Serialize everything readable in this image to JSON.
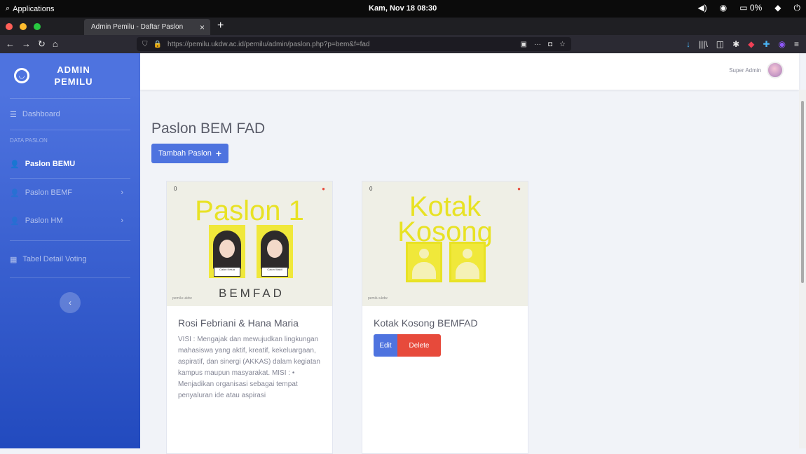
{
  "system": {
    "applications_label": "Applications",
    "clock": "Kam, Nov 18   08:30",
    "battery": "0%"
  },
  "browser": {
    "tab_title": "Admin Pemilu - Daftar Paslon",
    "url": "https://pemilu.ukdw.ac.id/pemilu/admin/paslon.php?p=bem&f=fad"
  },
  "sidebar": {
    "brand": "ADMIN PEMILU",
    "dashboard": "Dashboard",
    "heading": "Data Paslon",
    "items": [
      {
        "label": "Paslon BEMU",
        "active": true
      },
      {
        "label": "Paslon BEMF",
        "has_children": true
      },
      {
        "label": "Paslon HM",
        "has_children": true
      },
      {
        "label": "Tabel Detail Voting"
      }
    ]
  },
  "topbar": {
    "username": "Super Admin"
  },
  "page": {
    "title": "Paslon BEM FAD",
    "add_button": "Tambah Paslon"
  },
  "cards": [
    {
      "poster_number": "0",
      "poster_title": "Paslon 1",
      "poster_footer": "pemilu ukdw",
      "poster_bem": "BEMFAD",
      "name_tag_1": "Calon Ketua",
      "name_tag_2": "Calon Wakil",
      "title": "Rosi Febriani & Hana Maria",
      "text": "VISI : Mengajak dan mewujudkan lingkungan mahasiswa yang aktif, kreatif, kekeluargaan, aspiratif, dan sinergi (AKKAS) dalam kegiatan kampus maupun masyarakat. MISI : • Menjadikan organisasi sebagai tempat penyaluran ide atau aspirasi"
    },
    {
      "poster_number": "0",
      "poster_title_1": "Kotak",
      "poster_title_2": "Kosong",
      "poster_footer": "pemilu ukdw",
      "title": "Kotak Kosong BEMFAD",
      "edit_label": "Edit",
      "delete_label": "Delete"
    }
  ],
  "colors": {
    "primary": "#4e73df",
    "danger": "#e74a3b",
    "poster_yellow": "#e8e224"
  }
}
